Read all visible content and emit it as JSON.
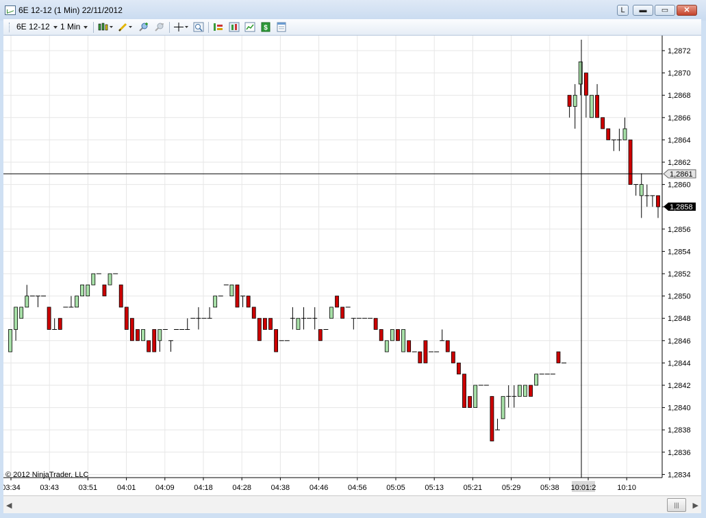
{
  "window": {
    "title": "6E 12-12 (1 Min)  22/11/2012",
    "buttons": {
      "link": "L",
      "minimize": "▬",
      "maximize": "▭",
      "close": "✕"
    }
  },
  "toolbar": {
    "instrument": "6E 12-12",
    "interval": "1 Min",
    "icons": [
      "candlestick-chart-icon",
      "pencil-draw-icon",
      "zoom-in-icon",
      "zoom-out-icon",
      "crosshair-icon",
      "magnifier-icon",
      "indicators-icon",
      "strategies-icon",
      "chart-properties-icon",
      "dollar-icon",
      "data-box-icon"
    ]
  },
  "chart": {
    "copyright": "© 2012 NinjaTrader, LLC",
    "crosshair_price": "1,2861",
    "crosshair_time": "10:01:2",
    "last_price": "1,2858",
    "colors": {
      "up": "#a8e0a8",
      "down": "#cc0000",
      "outline": "#000000",
      "grid": "#e6e6e6"
    },
    "price_axis": [
      "1,2872",
      "1,2870",
      "1,2868",
      "1,2866",
      "1,2864",
      "1,2862",
      "1,2860",
      "1,2858",
      "1,2856",
      "1,2854",
      "1,2852",
      "1,2850",
      "1,2848",
      "1,2846",
      "1,2844",
      "1,2842",
      "1,2840",
      "1,2838",
      "1,2836",
      "1,2834"
    ],
    "time_axis": [
      "03:34",
      "03:43",
      "03:51",
      "04:01",
      "04:09",
      "04:18",
      "04:28",
      "04:38",
      "04:46",
      "04:56",
      "05:05",
      "05:13",
      "05:21",
      "05:29",
      "05:38",
      "",
      "10:10"
    ]
  },
  "chart_data": {
    "type": "candlestick",
    "ylim": [
      1.2833,
      1.2873
    ],
    "bars": [
      {
        "o": 1.2845,
        "h": 1.2847,
        "l": 1.2845,
        "c": 1.2847
      },
      {
        "o": 1.2847,
        "h": 1.2848,
        "l": 1.2846,
        "c": 1.2849
      },
      {
        "o": 1.2848,
        "h": 1.2849,
        "l": 1.2848,
        "c": 1.2849
      },
      {
        "o": 1.2849,
        "h": 1.2851,
        "l": 1.2849,
        "c": 1.285
      },
      {
        "o": 1.285,
        "h": 1.285,
        "l": 1.285,
        "c": 1.285
      },
      {
        "o": 1.285,
        "h": 1.285,
        "l": 1.2849,
        "c": 1.285
      },
      {
        "o": 1.285,
        "h": 1.285,
        "l": 1.285,
        "c": 1.285
      },
      {
        "o": 1.2849,
        "h": 1.2849,
        "l": 1.2847,
        "c": 1.2847
      },
      {
        "o": 1.2847,
        "h": 1.2848,
        "l": 1.2847,
        "c": 1.2847
      },
      {
        "o": 1.2848,
        "h": 1.2848,
        "l": 1.2847,
        "c": 1.2847
      },
      {
        "o": 1.2849,
        "h": 1.2849,
        "l": 1.2849,
        "c": 1.2849
      },
      {
        "o": 1.2849,
        "h": 1.285,
        "l": 1.2849,
        "c": 1.2849
      },
      {
        "o": 1.2849,
        "h": 1.285,
        "l": 1.2849,
        "c": 1.285
      },
      {
        "o": 1.285,
        "h": 1.2851,
        "l": 1.285,
        "c": 1.2851
      },
      {
        "o": 1.285,
        "h": 1.2851,
        "l": 1.285,
        "c": 1.2851
      },
      {
        "o": 1.2851,
        "h": 1.2852,
        "l": 1.2851,
        "c": 1.2852
      },
      {
        "o": 1.2852,
        "h": 1.2852,
        "l": 1.2852,
        "c": 1.2852
      },
      {
        "o": 1.2851,
        "h": 1.2851,
        "l": 1.285,
        "c": 1.285
      },
      {
        "o": 1.2851,
        "h": 1.2852,
        "l": 1.2851,
        "c": 1.2852
      },
      {
        "o": 1.2852,
        "h": 1.2852,
        "l": 1.2852,
        "c": 1.2852
      },
      {
        "o": 1.2851,
        "h": 1.2851,
        "l": 1.2849,
        "c": 1.2849
      },
      {
        "o": 1.2849,
        "h": 1.2849,
        "l": 1.2847,
        "c": 1.2847
      },
      {
        "o": 1.2848,
        "h": 1.2848,
        "l": 1.2846,
        "c": 1.2846
      },
      {
        "o": 1.2847,
        "h": 1.2847,
        "l": 1.2846,
        "c": 1.2846
      },
      {
        "o": 1.2846,
        "h": 1.2847,
        "l": 1.2846,
        "c": 1.2847
      },
      {
        "o": 1.2846,
        "h": 1.2846,
        "l": 1.2845,
        "c": 1.2845
      },
      {
        "o": 1.2847,
        "h": 1.2847,
        "l": 1.2845,
        "c": 1.2845
      },
      {
        "o": 1.2846,
        "h": 1.2847,
        "l": 1.2845,
        "c": 1.2847
      },
      {
        "o": 1.2847,
        "h": 1.2847,
        "l": 1.2847,
        "c": 1.2847
      },
      {
        "o": 1.2846,
        "h": 1.2846,
        "l": 1.2845,
        "c": 1.2846
      },
      {
        "o": 1.2847,
        "h": 1.2847,
        "l": 1.2847,
        "c": 1.2847
      },
      {
        "o": 1.2847,
        "h": 1.2847,
        "l": 1.2847,
        "c": 1.2847
      },
      {
        "o": 1.2847,
        "h": 1.2848,
        "l": 1.2847,
        "c": 1.2847
      },
      {
        "o": 1.2848,
        "h": 1.2848,
        "l": 1.2848,
        "c": 1.2848
      },
      {
        "o": 1.2848,
        "h": 1.2849,
        "l": 1.2847,
        "c": 1.2848
      },
      {
        "o": 1.2848,
        "h": 1.2848,
        "l": 1.2848,
        "c": 1.2848
      },
      {
        "o": 1.2848,
        "h": 1.2849,
        "l": 1.2848,
        "c": 1.2848
      },
      {
        "o": 1.2849,
        "h": 1.285,
        "l": 1.2849,
        "c": 1.285
      },
      {
        "o": 1.285,
        "h": 1.285,
        "l": 1.285,
        "c": 1.285
      },
      {
        "o": 1.2851,
        "h": 1.2851,
        "l": 1.2851,
        "c": 1.2851
      },
      {
        "o": 1.285,
        "h": 1.2851,
        "l": 1.285,
        "c": 1.2851
      },
      {
        "o": 1.2851,
        "h": 1.2851,
        "l": 1.2849,
        "c": 1.2849
      },
      {
        "o": 1.285,
        "h": 1.285,
        "l": 1.2849,
        "c": 1.285
      },
      {
        "o": 1.285,
        "h": 1.285,
        "l": 1.2849,
        "c": 1.2849
      },
      {
        "o": 1.2849,
        "h": 1.2849,
        "l": 1.2848,
        "c": 1.2848
      },
      {
        "o": 1.2848,
        "h": 1.2848,
        "l": 1.2846,
        "c": 1.2846
      },
      {
        "o": 1.2848,
        "h": 1.2848,
        "l": 1.2847,
        "c": 1.2847
      },
      {
        "o": 1.2848,
        "h": 1.2848,
        "l": 1.2847,
        "c": 1.2847
      },
      {
        "o": 1.2847,
        "h": 1.2847,
        "l": 1.2845,
        "c": 1.2845
      },
      {
        "o": 1.2846,
        "h": 1.2846,
        "l": 1.2846,
        "c": 1.2846
      },
      {
        "o": 1.2846,
        "h": 1.2846,
        "l": 1.2846,
        "c": 1.2846
      },
      {
        "o": 1.2848,
        "h": 1.2849,
        "l": 1.2847,
        "c": 1.2848
      },
      {
        "o": 1.2847,
        "h": 1.2848,
        "l": 1.2847,
        "c": 1.2848
      },
      {
        "o": 1.2848,
        "h": 1.2849,
        "l": 1.2847,
        "c": 1.2848
      },
      {
        "o": 1.2848,
        "h": 1.2848,
        "l": 1.2848,
        "c": 1.2848
      },
      {
        "o": 1.2848,
        "h": 1.2849,
        "l": 1.2847,
        "c": 1.2848
      },
      {
        "o": 1.2847,
        "h": 1.2847,
        "l": 1.2846,
        "c": 1.2846
      },
      {
        "o": 1.2847,
        "h": 1.2847,
        "l": 1.2847,
        "c": 1.2847
      },
      {
        "o": 1.2848,
        "h": 1.2849,
        "l": 1.2848,
        "c": 1.2849
      },
      {
        "o": 1.285,
        "h": 1.285,
        "l": 1.2849,
        "c": 1.2849
      },
      {
        "o": 1.2849,
        "h": 1.2849,
        "l": 1.2848,
        "c": 1.2848
      },
      {
        "o": 1.2849,
        "h": 1.2849,
        "l": 1.2849,
        "c": 1.2849
      },
      {
        "o": 1.2848,
        "h": 1.2848,
        "l": 1.2847,
        "c": 1.2848
      },
      {
        "o": 1.2848,
        "h": 1.2848,
        "l": 1.2848,
        "c": 1.2848
      },
      {
        "o": 1.2848,
        "h": 1.2848,
        "l": 1.2848,
        "c": 1.2848
      },
      {
        "o": 1.2848,
        "h": 1.2848,
        "l": 1.2848,
        "c": 1.2848
      },
      {
        "o": 1.2848,
        "h": 1.2848,
        "l": 1.2847,
        "c": 1.2847
      },
      {
        "o": 1.2847,
        "h": 1.2847,
        "l": 1.2846,
        "c": 1.2846
      },
      {
        "o": 1.2845,
        "h": 1.2846,
        "l": 1.2845,
        "c": 1.2846
      },
      {
        "o": 1.2846,
        "h": 1.2847,
        "l": 1.2846,
        "c": 1.2847
      },
      {
        "o": 1.2847,
        "h": 1.2847,
        "l": 1.2846,
        "c": 1.2846
      },
      {
        "o": 1.2845,
        "h": 1.2847,
        "l": 1.2845,
        "c": 1.2847
      },
      {
        "o": 1.2846,
        "h": 1.2846,
        "l": 1.2845,
        "c": 1.2845
      },
      {
        "o": 1.2845,
        "h": 1.2845,
        "l": 1.2845,
        "c": 1.2845
      },
      {
        "o": 1.2845,
        "h": 1.2845,
        "l": 1.2844,
        "c": 1.2844
      },
      {
        "o": 1.2846,
        "h": 1.2846,
        "l": 1.2844,
        "c": 1.2844
      },
      {
        "o": 1.2845,
        "h": 1.2845,
        "l": 1.2845,
        "c": 1.2845
      },
      {
        "o": 1.2845,
        "h": 1.2845,
        "l": 1.2845,
        "c": 1.2845
      },
      {
        "o": 1.2846,
        "h": 1.2847,
        "l": 1.2846,
        "c": 1.2846
      },
      {
        "o": 1.2846,
        "h": 1.2846,
        "l": 1.2845,
        "c": 1.2845
      },
      {
        "o": 1.2845,
        "h": 1.2845,
        "l": 1.2844,
        "c": 1.2844
      },
      {
        "o": 1.2844,
        "h": 1.2844,
        "l": 1.2843,
        "c": 1.2843
      },
      {
        "o": 1.2843,
        "h": 1.2843,
        "l": 1.284,
        "c": 1.284
      },
      {
        "o": 1.2841,
        "h": 1.2841,
        "l": 1.284,
        "c": 1.284
      },
      {
        "o": 1.284,
        "h": 1.2842,
        "l": 1.284,
        "c": 1.2842
      },
      {
        "o": 1.2842,
        "h": 1.2842,
        "l": 1.2842,
        "c": 1.2842
      },
      {
        "o": 1.2842,
        "h": 1.2842,
        "l": 1.2842,
        "c": 1.2842
      },
      {
        "o": 1.2841,
        "h": 1.2841,
        "l": 1.2837,
        "c": 1.2837
      },
      {
        "o": 1.2838,
        "h": 1.2839,
        "l": 1.2838,
        "c": 1.2838
      },
      {
        "o": 1.2839,
        "h": 1.2841,
        "l": 1.2839,
        "c": 1.2841
      },
      {
        "o": 1.2841,
        "h": 1.2842,
        "l": 1.284,
        "c": 1.2841
      },
      {
        "o": 1.2841,
        "h": 1.2842,
        "l": 1.284,
        "c": 1.2841
      },
      {
        "o": 1.2841,
        "h": 1.2842,
        "l": 1.2841,
        "c": 1.2842
      },
      {
        "o": 1.2841,
        "h": 1.2842,
        "l": 1.2841,
        "c": 1.2842
      },
      {
        "o": 1.2842,
        "h": 1.2842,
        "l": 1.2841,
        "c": 1.2841
      },
      {
        "o": 1.2842,
        "h": 1.2843,
        "l": 1.2842,
        "c": 1.2843
      },
      {
        "o": 1.2843,
        "h": 1.2843,
        "l": 1.2843,
        "c": 1.2843
      },
      {
        "o": 1.2843,
        "h": 1.2843,
        "l": 1.2843,
        "c": 1.2843
      },
      {
        "o": 1.2843,
        "h": 1.2843,
        "l": 1.2843,
        "c": 1.2843
      },
      {
        "o": 1.2845,
        "h": 1.2845,
        "l": 1.2844,
        "c": 1.2844
      },
      {
        "o": 1.2844,
        "h": 1.2844,
        "l": 1.2844,
        "c": 1.2844
      },
      {
        "o": 1.2868,
        "h": 1.2868,
        "l": 1.2866,
        "c": 1.2867
      },
      {
        "o": 1.2867,
        "h": 1.2869,
        "l": 1.2865,
        "c": 1.2868
      },
      {
        "o": 1.2869,
        "h": 1.2871,
        "l": 1.2868,
        "c": 1.2871
      },
      {
        "o": 1.287,
        "h": 1.287,
        "l": 1.2866,
        "c": 1.2868
      },
      {
        "o": 1.2866,
        "h": 1.2868,
        "l": 1.2866,
        "c": 1.2868
      },
      {
        "o": 1.2868,
        "h": 1.2869,
        "l": 1.2866,
        "c": 1.2866
      },
      {
        "o": 1.2866,
        "h": 1.2866,
        "l": 1.2865,
        "c": 1.2865
      },
      {
        "o": 1.2865,
        "h": 1.2865,
        "l": 1.2864,
        "c": 1.2864
      },
      {
        "o": 1.2864,
        "h": 1.2864,
        "l": 1.2863,
        "c": 1.2864
      },
      {
        "o": 1.2864,
        "h": 1.2865,
        "l": 1.2863,
        "c": 1.2864
      },
      {
        "o": 1.2864,
        "h": 1.2866,
        "l": 1.2864,
        "c": 1.2865
      },
      {
        "o": 1.2864,
        "h": 1.2864,
        "l": 1.286,
        "c": 1.286
      },
      {
        "o": 1.286,
        "h": 1.286,
        "l": 1.2859,
        "c": 1.286
      },
      {
        "o": 1.2859,
        "h": 1.2861,
        "l": 1.2857,
        "c": 1.286
      },
      {
        "o": 1.2859,
        "h": 1.286,
        "l": 1.2858,
        "c": 1.2859
      },
      {
        "o": 1.2859,
        "h": 1.2859,
        "l": 1.2858,
        "c": 1.2859
      },
      {
        "o": 1.2859,
        "h": 1.2859,
        "l": 1.2857,
        "c": 1.2858
      }
    ]
  }
}
